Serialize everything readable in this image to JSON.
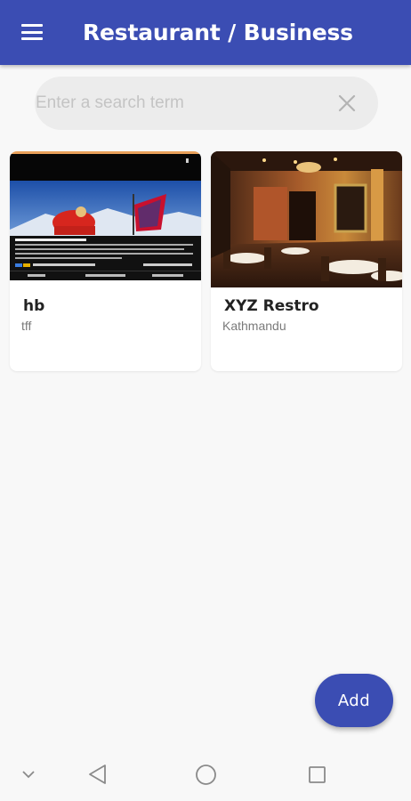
{
  "appbar": {
    "title": "Restaurant / Business",
    "color": "#3b4db3",
    "menu_icon": "hamburger-menu-icon"
  },
  "search": {
    "placeholder": "Enter a search term",
    "value": "",
    "clear_icon": "close-icon"
  },
  "cards": [
    {
      "name": "hb",
      "subtitle": "tff",
      "image": "himalaya-social-post-screenshot"
    },
    {
      "name": "XYZ Restro",
      "subtitle": "Kathmandu",
      "image": "restaurant-interior-photo"
    }
  ],
  "fab": {
    "label": "Add",
    "color": "#3b4db3"
  },
  "navbar": {
    "icons": [
      "chevron-down-icon",
      "back-triangle-icon",
      "home-circle-icon",
      "recents-square-icon"
    ]
  }
}
